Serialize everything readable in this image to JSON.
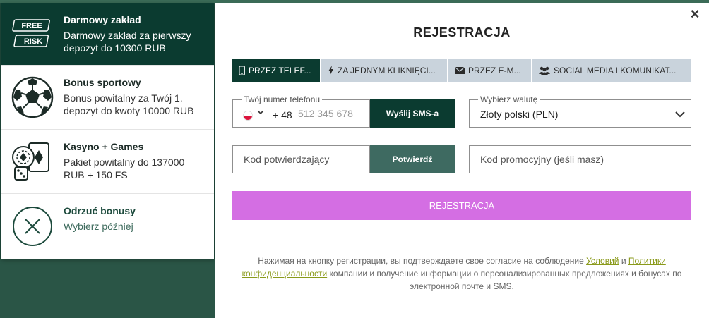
{
  "bonuses": [
    {
      "id": "free-bet",
      "title": "Darmowy zakład",
      "desc": "Darmowy zakład za pierwszy depozyt do 10300 RUB",
      "icon": "free-risk-icon",
      "badge_top": "FREE",
      "badge_bottom": "RISK",
      "active": true
    },
    {
      "id": "sport",
      "title": "Bonus sportowy",
      "desc": "Bonus powitalny za Twój 1. depozyt do kwoty 10000 RUB",
      "icon": "soccer-ball-icon",
      "active": false
    },
    {
      "id": "casino",
      "title": "Kasyno + Games",
      "desc": "Pakiet powitalny do 137000 RUB + 150 FS",
      "icon": "casino-chips-cards-icon",
      "active": false
    },
    {
      "id": "decline",
      "title": "Odrzuć bonusy",
      "desc": "Wybierz później",
      "icon": "decline-x-icon",
      "active": false
    }
  ],
  "modal": {
    "title": "REJESTRACJA",
    "close_icon": "×",
    "tabs": [
      {
        "label": "PRZEZ TELEF...",
        "icon": "phone-icon",
        "active": true
      },
      {
        "label": "ZA JEDNYM KLIKNIĘCI...",
        "icon": "lightning-icon",
        "active": false
      },
      {
        "label": "PRZEZ E-M...",
        "icon": "envelope-icon",
        "active": false
      },
      {
        "label": "SOCIAL MEDIA I KOMUNIKAT...",
        "icon": "people-icon",
        "active": false
      }
    ],
    "phone": {
      "legend": "Twój numer telefonu",
      "country_code": "+ 48",
      "placeholder": "512 345 678",
      "flag_icon": "poland-flag-icon",
      "send_sms_label": "Wyślij SMS-a"
    },
    "currency": {
      "legend": "Wybierz walutę",
      "value": "Złoty polski (PLN)"
    },
    "code": {
      "placeholder": "Kod potwierdzający",
      "confirm_label": "Potwierdź"
    },
    "promo": {
      "placeholder": "Kod promocyjny (jeśli masz)"
    },
    "register_label": "REJESTRACJA",
    "legal": {
      "part1": "Нажимая на кнопку регистрации, вы подтверждаете свое согласие на соблюдение ",
      "link1": "Условий",
      "part2": " и ",
      "link2": "Политики конфиденциальности",
      "part3": " компании и получение информации о персонализированных предложениях и бонусах по электронной почте и SMS."
    }
  },
  "colors": {
    "dark_green": "#0b3b30",
    "confirm_green": "#3e6a61",
    "register_pink": "#d46ee3",
    "tab_grey": "#c9d3dc",
    "link_olive": "#8a9a1a"
  }
}
